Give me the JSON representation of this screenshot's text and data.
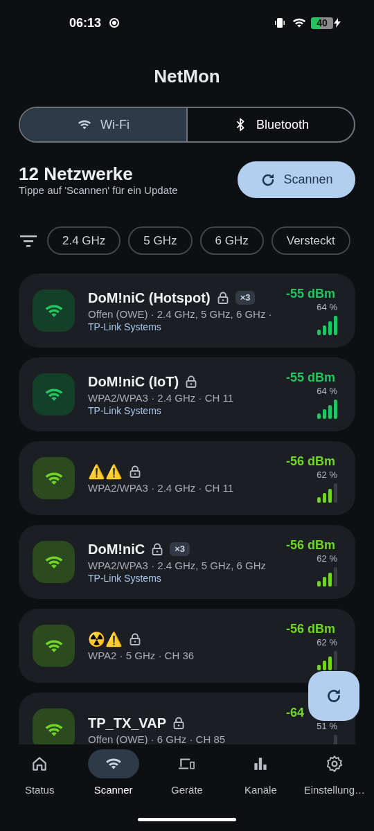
{
  "status_bar": {
    "time": "06:13",
    "battery": "40"
  },
  "app_title": "NetMon",
  "mode_tabs": [
    {
      "label": "Wi-Fi",
      "kind": "wifi",
      "selected": true
    },
    {
      "label": "Bluetooth",
      "kind": "bluetooth",
      "selected": false
    }
  ],
  "summary": {
    "count": "12 Netzwerke",
    "hint": "Tippe auf 'Scannen' für ein Update"
  },
  "scan_button": "Scannen",
  "filters": [
    {
      "label": "2.4 GHz",
      "selected": false
    },
    {
      "label": "5 GHz",
      "selected": false
    },
    {
      "label": "6 GHz",
      "selected": false
    },
    {
      "label": "Versteckt",
      "selected": false
    }
  ],
  "networks": [
    {
      "name": "DoM!niC (Hotspot)",
      "locked": true,
      "badge": "×3",
      "details": "Offen (OWE) · 2.4 GHz, 5 GHz, 6 GHz ·",
      "vendor": "TP-Link Systems",
      "dbm": "-55 dBm",
      "percent": "64 %",
      "bars": [
        {
          "on": true
        },
        {
          "on": true
        },
        {
          "on": true
        },
        {
          "on": true
        }
      ],
      "color": "#22c55e"
    },
    {
      "name": "DoM!niC (IoT)",
      "locked": true,
      "details": "WPA2/WPA3 · 2.4 GHz · CH 11",
      "vendor": "TP-Link Systems",
      "dbm": "-55 dBm",
      "percent": "64 %",
      "bars": [
        {
          "on": true
        },
        {
          "on": true
        },
        {
          "on": true
        },
        {
          "on": true
        }
      ],
      "color": "#22c55e"
    },
    {
      "name": "⚠️⚠️",
      "locked": true,
      "details": "WPA2/WPA3 · 2.4 GHz · CH 11",
      "dbm": "-56 dBm",
      "percent": "62 %",
      "bars": [
        {
          "on": true
        },
        {
          "on": true
        },
        {
          "on": true
        },
        {
          "on": false
        }
      ],
      "color": "#6fd626"
    },
    {
      "name": "DoM!niC",
      "locked": true,
      "badge": "×3",
      "details": "WPA2/WPA3 · 2.4 GHz, 5 GHz, 6 GHz",
      "vendor": "TP-Link Systems",
      "dbm": "-56 dBm",
      "percent": "62 %",
      "bars": [
        {
          "on": true
        },
        {
          "on": true
        },
        {
          "on": true
        },
        {
          "on": false
        }
      ],
      "color": "#6fd626"
    },
    {
      "name": "☢️⚠️",
      "locked": true,
      "details": "WPA2 · 5 GHz · CH 36",
      "dbm": "-56 dBm",
      "percent": "62 %",
      "bars": [
        {
          "on": true
        },
        {
          "on": true
        },
        {
          "on": true
        },
        {
          "on": false
        }
      ],
      "color": "#6fd626"
    },
    {
      "name": "TP_TX_VAP",
      "locked": true,
      "details": "Offen (OWE) · 6 GHz · CH 85",
      "dbm": "-64",
      "percent": "51 %",
      "bars": [
        {
          "on": false
        }
      ],
      "color": "#6fd626"
    }
  ],
  "nav": [
    {
      "label": "Status",
      "kind": "home",
      "selected": false
    },
    {
      "label": "Scanner",
      "kind": "wifi",
      "selected": true
    },
    {
      "label": "Geräte",
      "kind": "devices",
      "selected": false
    },
    {
      "label": "Kanäle",
      "kind": "bars",
      "selected": false
    },
    {
      "label": "Einstellung…",
      "kind": "gear",
      "selected": false
    }
  ]
}
